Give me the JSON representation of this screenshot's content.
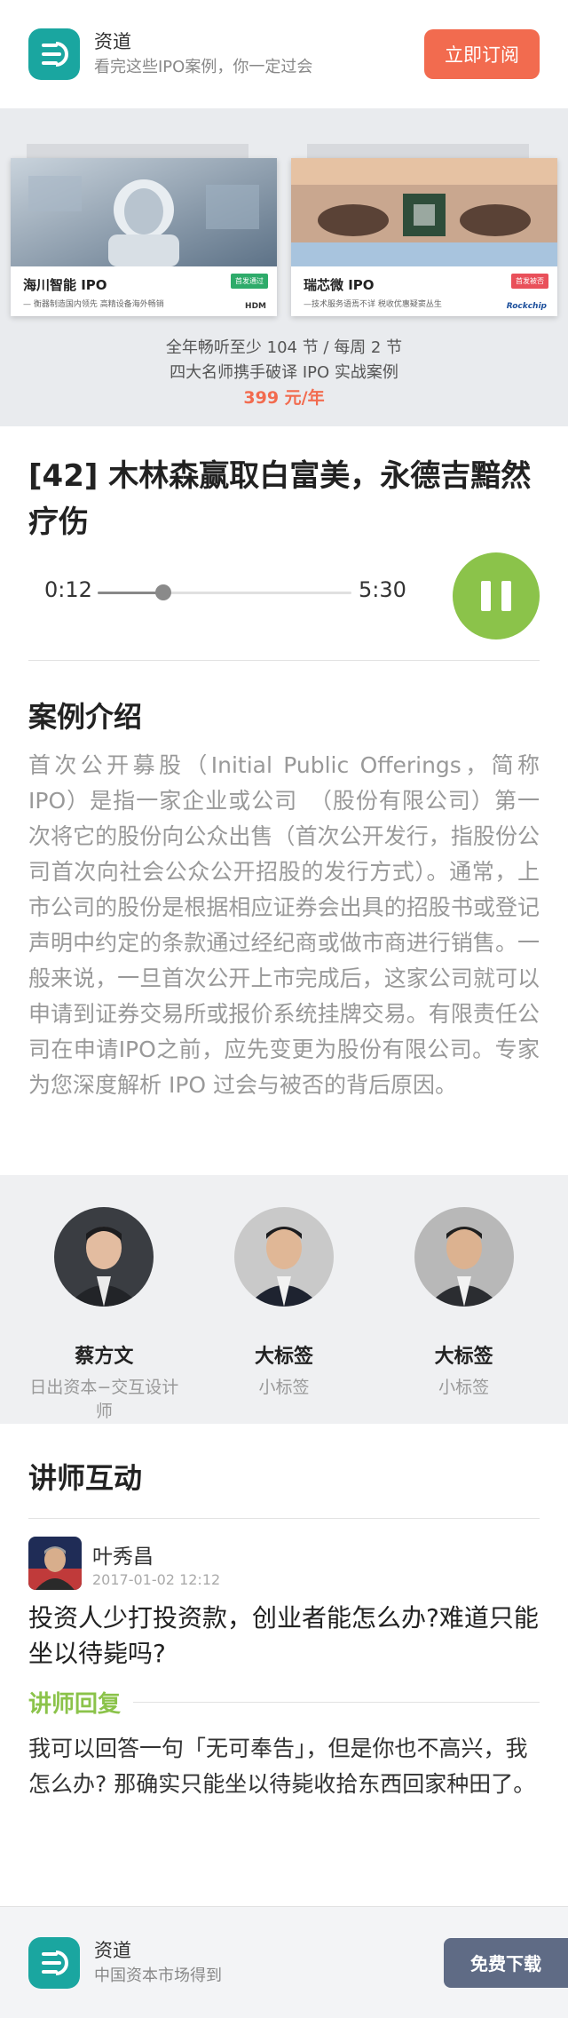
{
  "header": {
    "app_name": "资道",
    "tagline": "看完这些IPO案例，你一定过会",
    "subscribe_label": "立即订阅"
  },
  "promo": {
    "card_left": {
      "title": "海川智能 IPO",
      "subtitle": "— 衡器制造国内领先 高精设备海外畅销",
      "tag": "首发通过",
      "brand": "HDM"
    },
    "card_right": {
      "title": "瑞芯微 IPO",
      "subtitle": "—技术服务语焉不详 税收优惠疑窦丛生",
      "tag": "首发被否",
      "brand": "Rockchip"
    },
    "line1": "全年畅听至少 104 节 / 每周 2 节",
    "line2": "四大名师携手破译 IPO 实战案例",
    "price": "399 元/年"
  },
  "episode": {
    "title": "[42] 木林森赢取白富美，永德吉黯然疗伤"
  },
  "player": {
    "current_time": "0:12",
    "total_time": "5:30",
    "progress": 0.26
  },
  "intro": {
    "heading": "案例介绍",
    "body": "首次公开募股（Initial Public Offerings，简称IPO）是指一家企业或公司　（股份有限公司）第一次将它的股份向公众出售（首次公开发行，指股份公司首次向社会公众公开招股的发行方式）。通常，上市公司的股份是根据相应证券会出具的招股书或登记声明中约定的条款通过经纪商或做市商进行销售。一般来说，一旦首次公开上市完成后，这家公司就可以申请到证券交易所或报价系统挂牌交易。有限责任公司在申请IPO之前，应先变更为股份有限公司。专家为您深度解析 IPO 过会与被否的背后原因。"
  },
  "teachers": [
    {
      "name": "蔡方文",
      "role": "日出资本−交互设计师"
    },
    {
      "name": "大标签",
      "role": "小标签"
    },
    {
      "name": "大标签",
      "role": "小标签"
    }
  ],
  "interaction": {
    "heading": "讲师互动",
    "comment": {
      "user": "叶秀昌",
      "date": "2017-01-02 12:12",
      "question": "投资人少打投资款，创业者能怎么办?难道只能坐以待毙吗?",
      "reply_label": "讲师回复",
      "reply": "我可以回答一句「无可奉告」，但是你也不高兴，我怎么办? 那确实只能坐以待毙收拾东西回家种田了。"
    }
  },
  "footer": {
    "app_name": "资道",
    "tagline": "中国资本市场得到",
    "download_label": "免费下载"
  },
  "colors": {
    "brand": "#1aa6a0",
    "accent": "#f26b4f",
    "play": "#8bc34a",
    "download": "#5f6b85"
  }
}
